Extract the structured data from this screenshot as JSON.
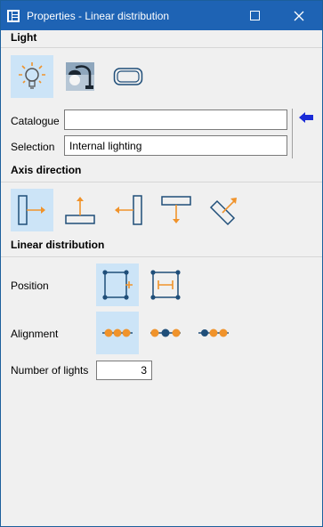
{
  "window": {
    "title": "Properties - Linear distribution"
  },
  "sections": {
    "light": "Light",
    "axis_direction": "Axis direction",
    "linear_distribution": "Linear distribution"
  },
  "light": {
    "catalogue_label": "Catalogue",
    "catalogue_value": "",
    "selection_label": "Selection",
    "selection_value": "Internal lighting"
  },
  "distribution": {
    "position_label": "Position",
    "alignment_label": "Alignment",
    "number_label": "Number of lights",
    "number_value": "3"
  },
  "colors": {
    "titlebar": "#1e63b4",
    "selected": "#cce4f7",
    "accent_orange": "#f0932b",
    "accent_blue": "#1f4e79"
  },
  "icons": {
    "light_types": [
      "bulb-icon",
      "desk-lamp-icon",
      "panel-light-icon"
    ],
    "axis": [
      "axis-right-icon",
      "axis-up-icon",
      "axis-left-icon",
      "axis-down-icon",
      "axis-diagonal-icon"
    ],
    "position": [
      "position-corner-icon",
      "position-span-icon"
    ],
    "alignment": [
      "alignment-centered-icon",
      "alignment-start-icon",
      "alignment-end-icon"
    ]
  }
}
